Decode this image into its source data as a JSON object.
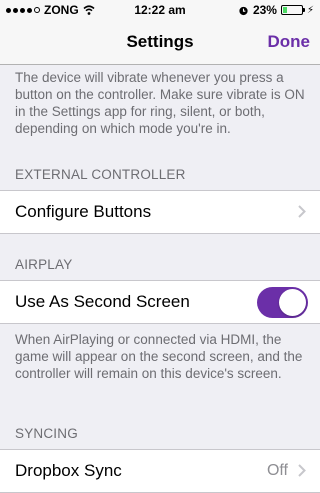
{
  "status_bar": {
    "carrier": "ZONG",
    "time": "12:22 am",
    "battery_percent": "23%",
    "battery_level": 0.23
  },
  "nav": {
    "title": "Settings",
    "done_label": "Done"
  },
  "intro_note": "The device will vibrate whenever you press a button on the controller. Make sure vibrate is ON in the Settings app for ring, silent, or both, depending on which mode you're in.",
  "sections": {
    "external_controller": {
      "header": "EXTERNAL CONTROLLER",
      "configure_label": "Configure Buttons"
    },
    "airplay": {
      "header": "AIRPLAY",
      "second_screen_label": "Use As Second Screen",
      "second_screen_on": true,
      "footer": "When AirPlaying or connected via HDMI, the game will appear on the second screen, and the controller will remain on this device's screen."
    },
    "syncing": {
      "header": "SYNCING",
      "dropbox_label": "Dropbox Sync",
      "dropbox_value": "Off"
    }
  },
  "colors": {
    "accent": "#6b2fa8",
    "background": "#efeff4",
    "secondary_text": "#6d6d72"
  }
}
